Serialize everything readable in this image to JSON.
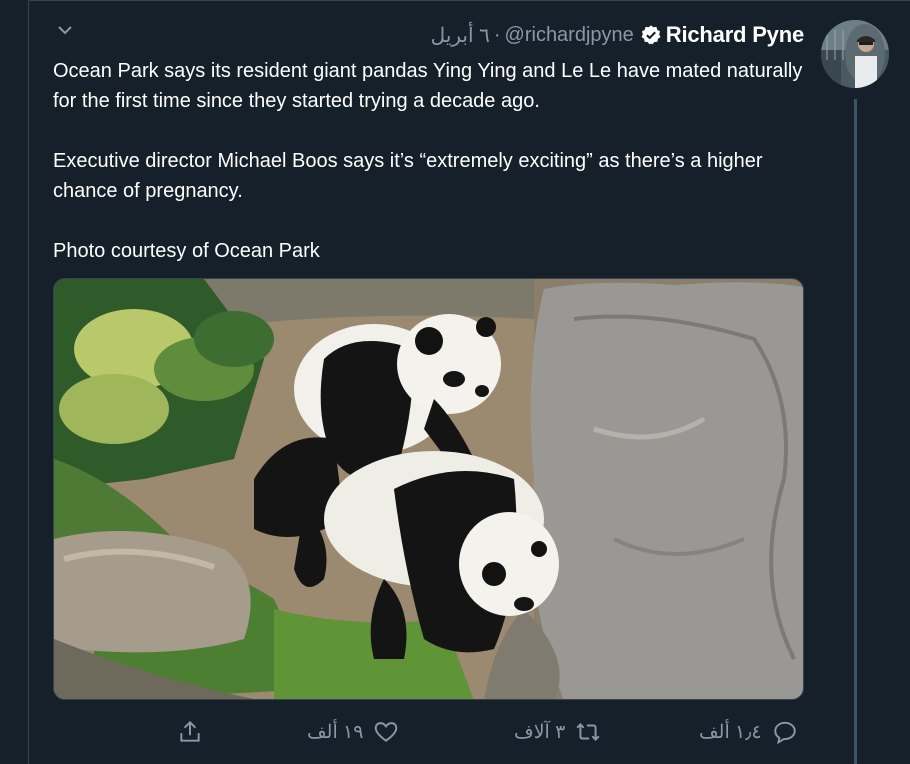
{
  "tweet": {
    "author": {
      "display_name": "Richard Pyne",
      "handle": "@richardjpyne",
      "verified": true
    },
    "separator": "·",
    "date": "٦ أبريل",
    "paragraphs": [
      "Ocean Park says its resident giant pandas Ying Ying and Le Le have mated naturally for the first time since they started trying a decade ago.",
      "Executive director Michael Boos says it’s “extremely exciting” as there’s a higher chance of pregnancy.",
      "Photo courtesy of Ocean Park"
    ],
    "media": {
      "subject": "two giant pandas beside a large rock"
    },
    "actions": {
      "reply_count": "١٫٤ ألف",
      "retweet_count": "٣ آلاف",
      "like_count": "١٩ ألف"
    }
  },
  "colors": {
    "background": "#15202b",
    "text": "#ffffff",
    "secondary_text": "#8899a6",
    "accent": "#1da1f2",
    "border": "#38444d"
  },
  "icons": {
    "menu": "chevron-down-icon",
    "verified": "verified-badge-icon",
    "reply": "reply-icon",
    "retweet": "retweet-icon",
    "like": "heart-icon",
    "share": "share-icon"
  }
}
